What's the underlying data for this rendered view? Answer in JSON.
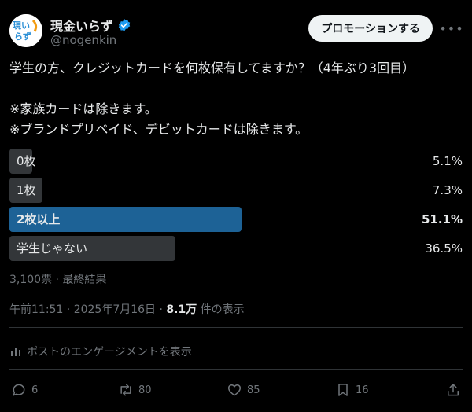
{
  "header": {
    "display_name": "現金いらず",
    "handle": "@nogenkin",
    "promo_label": "プロモーションする",
    "more_label": "•••"
  },
  "tweet": {
    "text": "学生の方、クレジットカードを何枚保有してますか？（4年ぶり3回目）\n\n※家族カードは除きます。\n※ブランドプリペイド、デビットカードは除きます。"
  },
  "poll": {
    "options": [
      {
        "label": "0枚",
        "percent_text": "5.1%",
        "percent": 5.1
      },
      {
        "label": "1枚",
        "percent_text": "7.3%",
        "percent": 7.3
      },
      {
        "label": "2枚以上",
        "percent_text": "51.1%",
        "percent": 51.1,
        "winner": true
      },
      {
        "label": "学生じゃない",
        "percent_text": "36.5%",
        "percent": 36.5
      }
    ],
    "meta": "3,100票 · 最終結果"
  },
  "timestamp": {
    "time": "午前11:51 · 2025年7月16日 · ",
    "views": "8.1万",
    "views_suffix": " 件の表示"
  },
  "engagement": {
    "label": "ポストのエンゲージメントを表示"
  },
  "actions": {
    "replies": "6",
    "reposts": "80",
    "likes": "85",
    "bookmarks": "16"
  },
  "colors": {
    "background": "#000000",
    "winner_bar": "#1d6296",
    "bar": "#333639",
    "muted": "#71767b",
    "verified": "#1d9bf0"
  }
}
